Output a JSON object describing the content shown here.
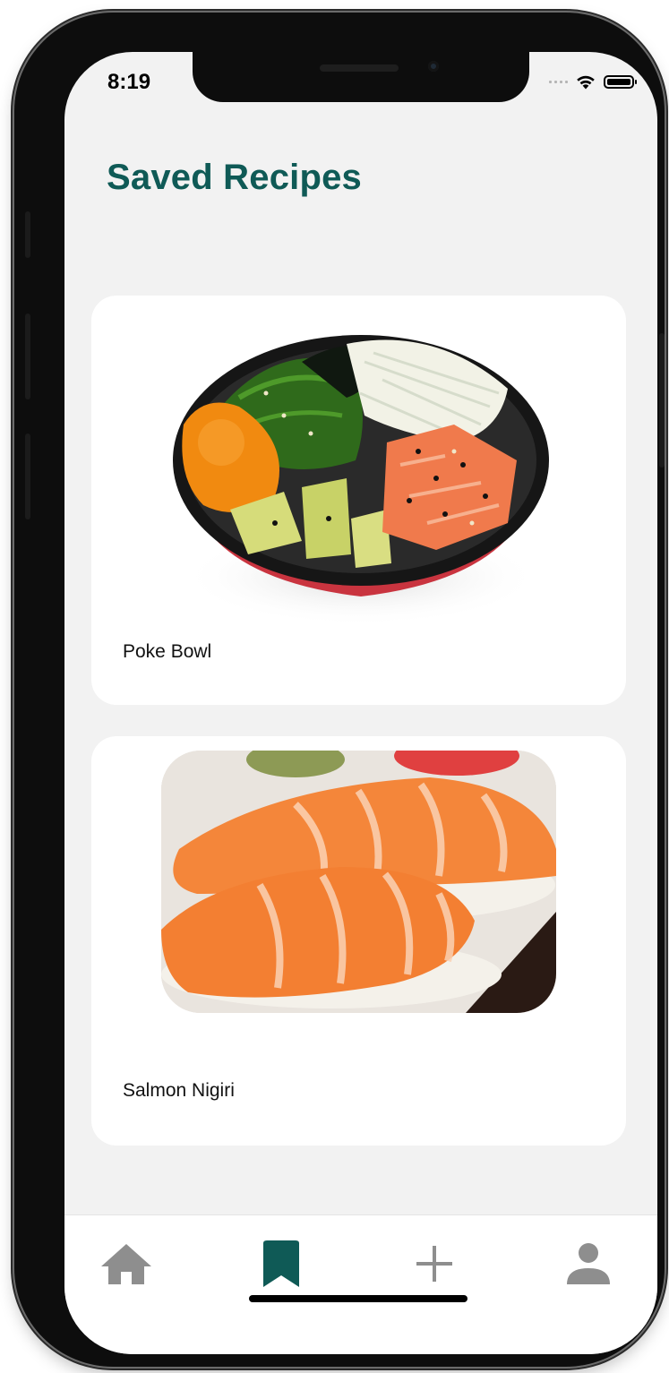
{
  "status_bar": {
    "time": "8:19"
  },
  "page": {
    "title": "Saved Recipes"
  },
  "recipes": [
    {
      "name": "Poke Bowl",
      "image": "poke-bowl-photo"
    },
    {
      "name": "Salmon Nigiri",
      "image": "salmon-nigiri-photo"
    }
  ],
  "tab_bar": {
    "items": [
      {
        "icon": "home-icon",
        "active": false
      },
      {
        "icon": "bookmark-icon",
        "active": true
      },
      {
        "icon": "plus-icon",
        "active": false
      },
      {
        "icon": "person-icon",
        "active": false
      }
    ]
  },
  "colors": {
    "accent": "#0f5a56",
    "inactive_icon": "#8e8e8e",
    "background": "#f2f2f2",
    "card": "#ffffff"
  }
}
